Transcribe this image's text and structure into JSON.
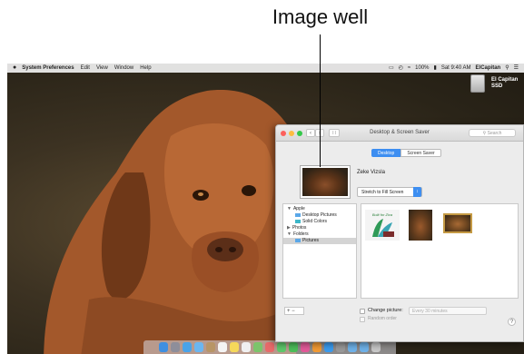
{
  "callout": {
    "label": "Image well"
  },
  "menubar": {
    "apple": "",
    "app_name": "System Preferences",
    "items": [
      "Edit",
      "View",
      "Window",
      "Help"
    ],
    "battery": "100%",
    "clock": "Sat 9:40 AM",
    "user": "ElCapitan"
  },
  "desktop": {
    "drive_label_line1": "El Capitan",
    "drive_label_line2": "SSD"
  },
  "window": {
    "title": "Desktop & Screen Saver",
    "search_placeholder": "Search",
    "tabs": [
      "Desktop",
      "Screen Saver"
    ],
    "active_tab": "Desktop",
    "picture_name": "Zeke Vizsla",
    "fit_option": "Stretch to Fill Screen",
    "sidebar": {
      "apple_group": "Apple",
      "desktop_pictures": "Desktop Pictures",
      "solid_colors": "Solid Colors",
      "photos": "Photos",
      "folders_group": "Folders",
      "pictures": "Pictures"
    },
    "thumbnail_1_caption": "Built for Ziva",
    "plus_minus": "+ −",
    "change_picture_label": "Change picture:",
    "change_interval": "Every 30 minutes",
    "random_order_label": "Random order",
    "help": "?"
  },
  "colors": {
    "accent": "#3d8ef1",
    "close": "#fc605c",
    "minimize": "#fdbc40",
    "zoom": "#34c84a"
  },
  "dock": {
    "icons": [
      "finder-icon",
      "launchpad-icon",
      "safari-icon",
      "mail-icon",
      "contacts-icon",
      "calendar-icon",
      "notes-icon",
      "reminders-icon",
      "maps-icon",
      "photos-icon",
      "messages-icon",
      "facetime-icon",
      "itunes-icon",
      "ibooks-icon",
      "app-store-icon",
      "system-preferences-icon",
      "folder-icon",
      "folder-icon",
      "trash-icon"
    ]
  }
}
